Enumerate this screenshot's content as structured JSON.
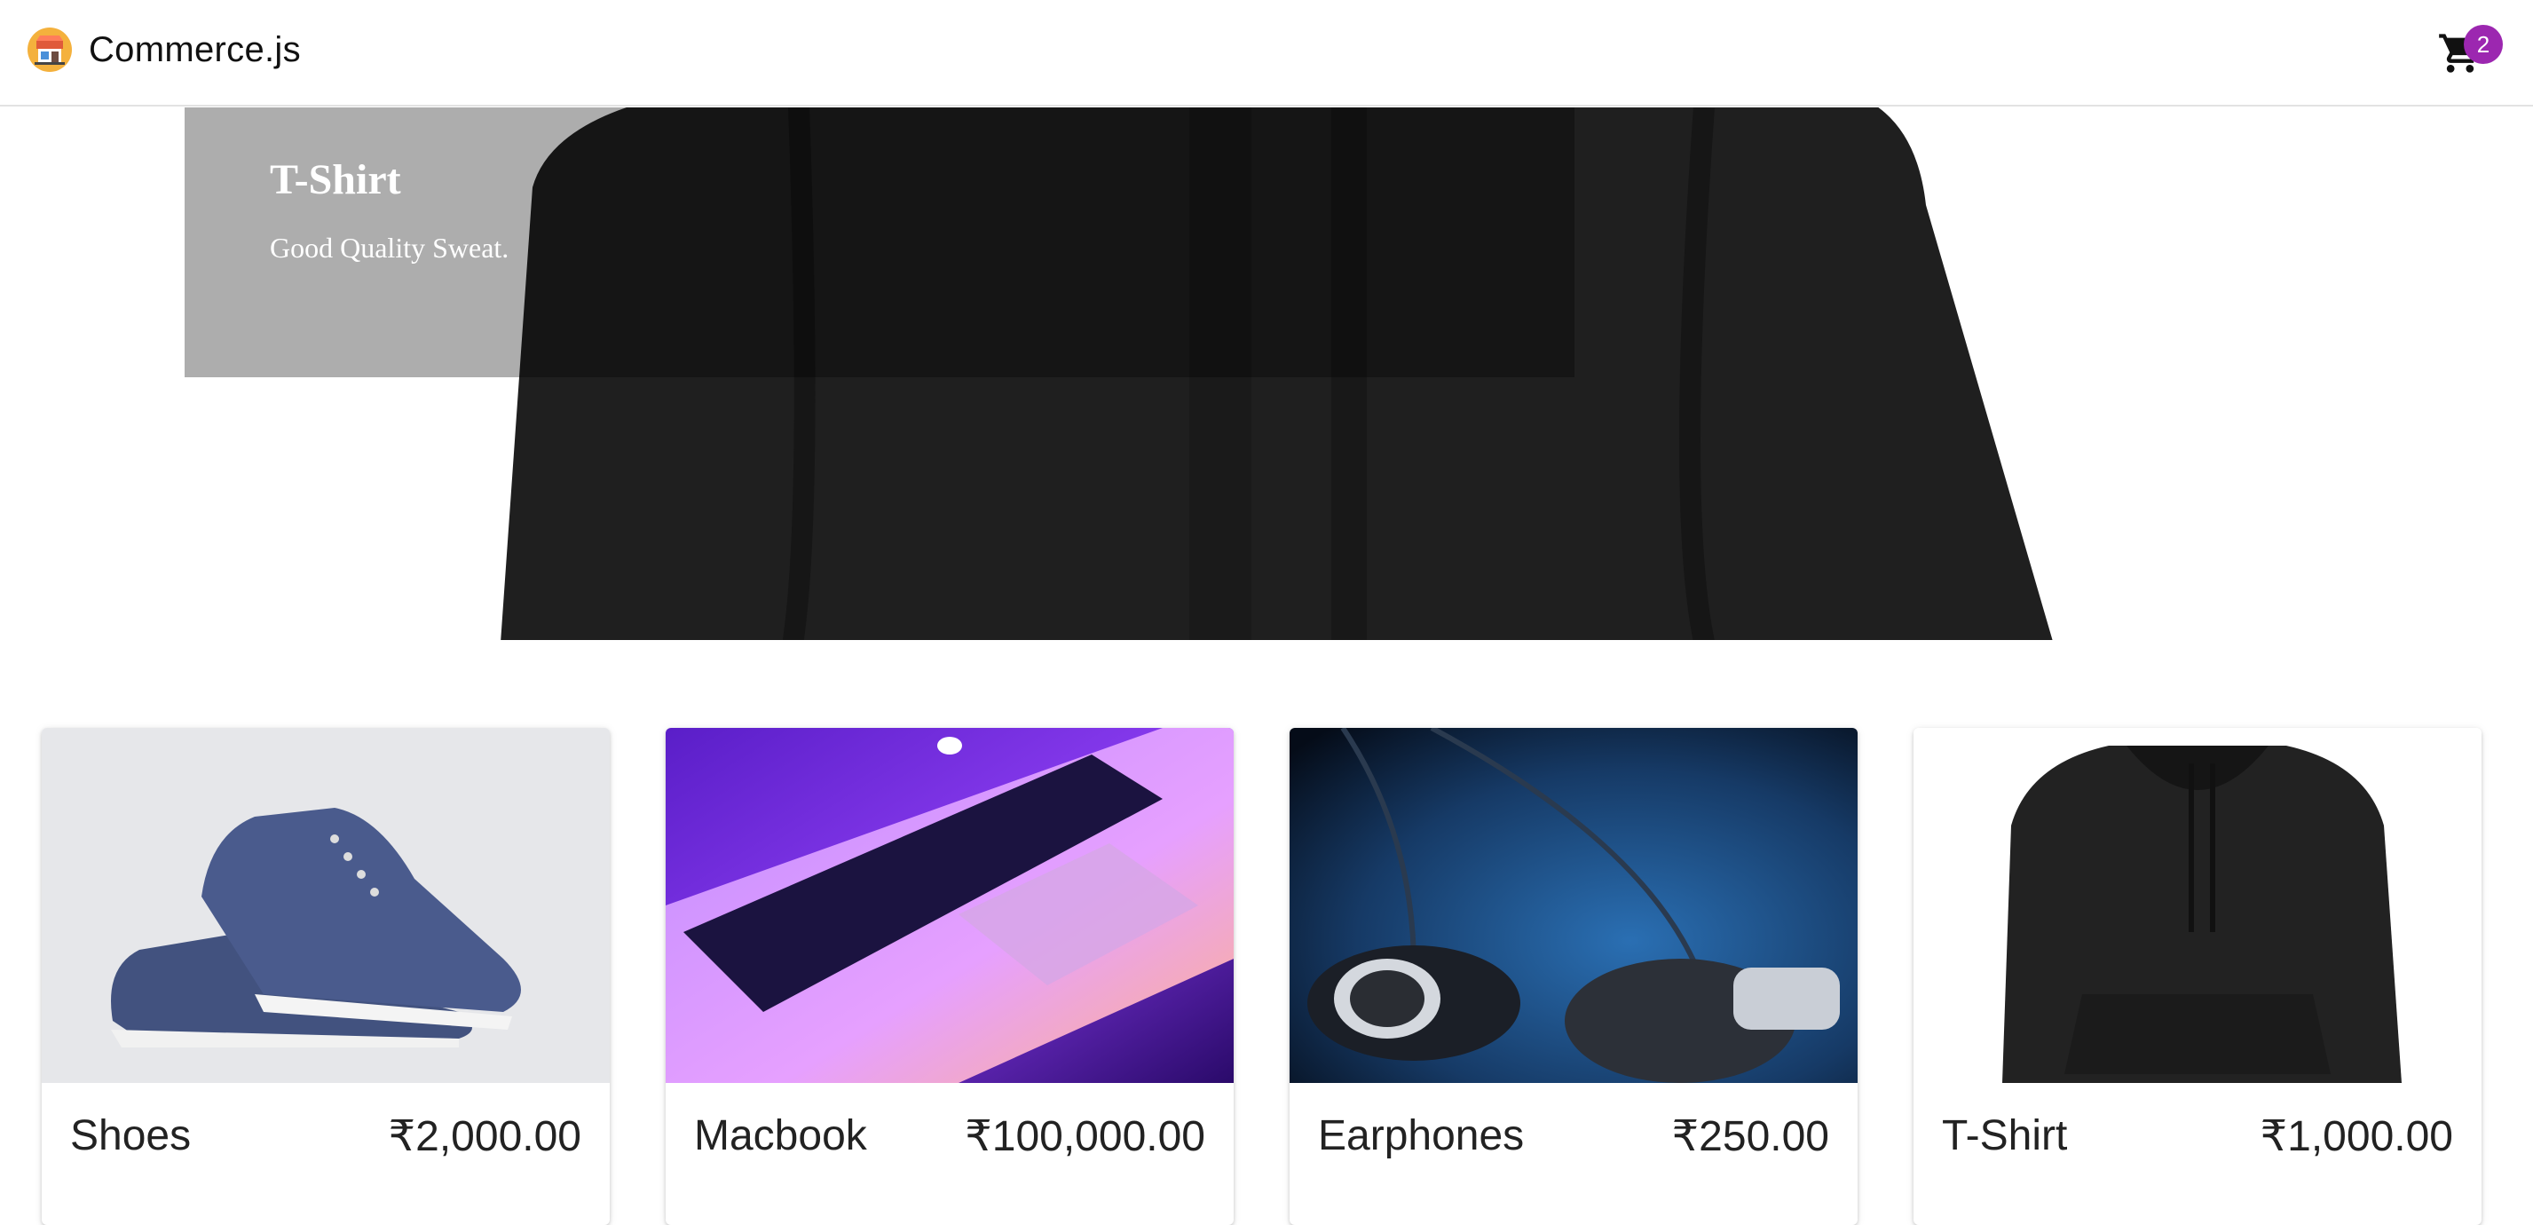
{
  "app": {
    "brand": "Commerce.js",
    "cart_count": "2"
  },
  "hero": {
    "title": "T-Shirt",
    "subtitle": "Good Quality Sweat."
  },
  "products": [
    {
      "name": "Shoes",
      "price": "₹2,000.00"
    },
    {
      "name": "Macbook",
      "price": "₹100,000.00"
    },
    {
      "name": "Earphones",
      "price": "₹250.00"
    },
    {
      "name": "T-Shirt",
      "price": "₹1,000.00"
    }
  ],
  "colors": {
    "badge": "#9c27b0",
    "text": "#222222"
  },
  "icons": {
    "logo": "store-logo-icon",
    "cart": "shopping-cart-icon"
  }
}
